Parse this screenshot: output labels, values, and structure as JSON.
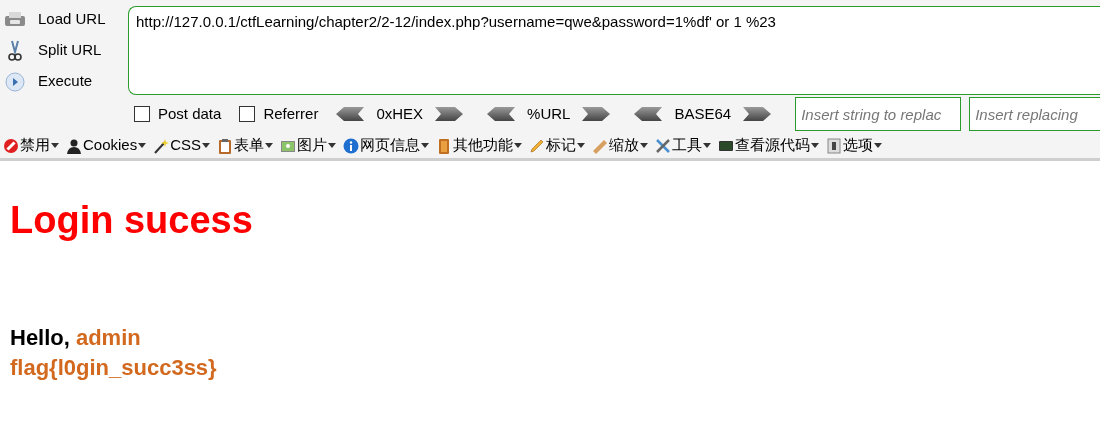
{
  "side_buttons": [
    {
      "label": "Load URL"
    },
    {
      "label": "Split URL"
    },
    {
      "label": "Execute"
    }
  ],
  "url_field": {
    "value": "http://127.0.0.1/ctfLearning/chapter2/2-12/index.php?username=qwe&password=1%df' or 1 %23"
  },
  "options": [
    {
      "label": "Post data",
      "checked": false
    },
    {
      "label": "Referrer",
      "checked": false
    }
  ],
  "encoders": [
    {
      "label": "0xHEX"
    },
    {
      "label": "%URL"
    },
    {
      "label": "BASE64"
    }
  ],
  "replace_fields": [
    {
      "placeholder": "Insert string to replac"
    },
    {
      "placeholder": "Insert replacing"
    }
  ],
  "menu": [
    {
      "label": "禁用"
    },
    {
      "label": "Cookies"
    },
    {
      "label": "CSS"
    },
    {
      "label": "表单"
    },
    {
      "label": "图片"
    },
    {
      "label": "网页信息"
    },
    {
      "label": "其他功能"
    },
    {
      "label": "标记"
    },
    {
      "label": "缩放"
    },
    {
      "label": "工具"
    },
    {
      "label": "查看源代码"
    },
    {
      "label": "选项"
    }
  ],
  "page": {
    "heading": "Login sucess",
    "greeting": "Hello,",
    "user": "admin",
    "flag": "flag{l0gin_succ3ss}"
  }
}
